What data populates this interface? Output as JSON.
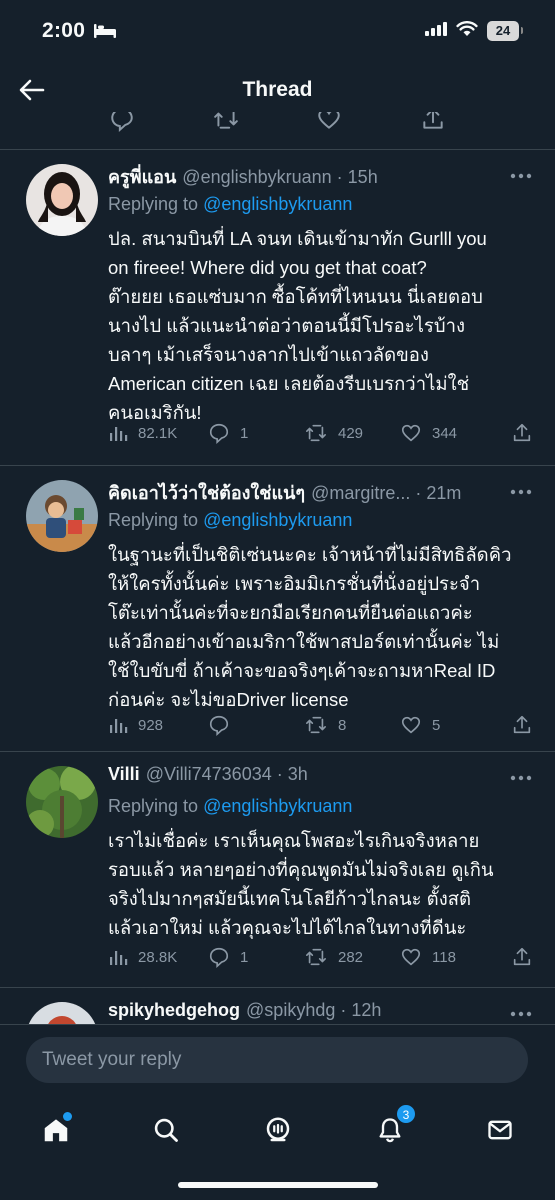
{
  "status_bar": {
    "time": "2:00",
    "battery": "24"
  },
  "header": {
    "title": "Thread"
  },
  "tweets": [
    {
      "name": "ครูพี่แอน",
      "handle": "@englishbykruann",
      "time": "15h",
      "replying_prefix": "Replying to",
      "replying_to": "@englishbykruann",
      "text": "ปล. สนามบินที่ LA จนท เดินเข้ามาทัก Gurlll you\non fireee! Where did you get that coat?\nต๊ายยย เธอแซ่บมาก ซื้อโค้ทที่ไหนนน นี่เลยตอบ\nนางไป แล้วแนะนำต่อว่าตอนนี้มีโปรอะไรบ้าง\nบลาๆ เม้าเสร็จนางลากไปเข้าแถวลัดของ\nAmerican citizen เฉย เลยต้องรีบเบรกว่าไม่ใช่\nคนอเมริกัน!",
      "views": "82.1K",
      "replies": "1",
      "retweets": "429",
      "likes": "344"
    },
    {
      "name": "คิดเอาไว้ว่าใช่ต้องใช่แน่ๆ",
      "handle": "@margitre...",
      "time": "21m",
      "replying_prefix": "Replying to",
      "replying_to": "@englishbykruann",
      "text": "ในฐานะที่เป็นชิติเซ่นนะคะ เจ้าหน้าที่ไม่มีสิทธิลัดคิว\nให้ใครทั้งนั้นค่ะ เพราะอิมมิเกรชั่นที่นั่งอยู่ประจำ\nโต๊ะเท่านั้นค่ะที่จะยกมือเรียกคนที่ยืนต่อแถวค่ะ\nแล้วอีกอย่างเข้าอเมริกาใช้พาสปอร์ตเท่านั้นค่ะ ไม่\nใช้ใบขับขี่ ถ้าเค้าจะขอจริงๆเค้าจะถามหาReal ID\nก่อนค่ะ จะไม่ขอDriver license",
      "views": "928",
      "replies": "",
      "retweets": "8",
      "likes": "5"
    },
    {
      "name": "Villi",
      "handle": "@Villi74736034",
      "time": "3h",
      "replying_prefix": "Replying to",
      "replying_to": "@englishbykruann",
      "text": "เราไม่เชื่อค่ะ เราเห็นคุณโพสอะไรเกินจริงหลาย\nรอบแล้ว หลายๆอย่างที่คุณพูดมันไม่จริงเลย ดูเกิน\nจริงไปมากๆสมัยนี้เทคโนโลยีก้าวไกลนะ ตั้งสติ\nแล้วเอาใหม่ แล้วคุณจะไปได้ไกลในทางที่ดีนะ",
      "views": "28.8K",
      "replies": "1",
      "retweets": "282",
      "likes": "118"
    },
    {
      "name": "spikyhedgehog",
      "handle": "@spikyhdg",
      "time": "12h"
    }
  ],
  "compose": {
    "placeholder": "Tweet your reply"
  },
  "tabbar": {
    "notifications_count": "3"
  }
}
